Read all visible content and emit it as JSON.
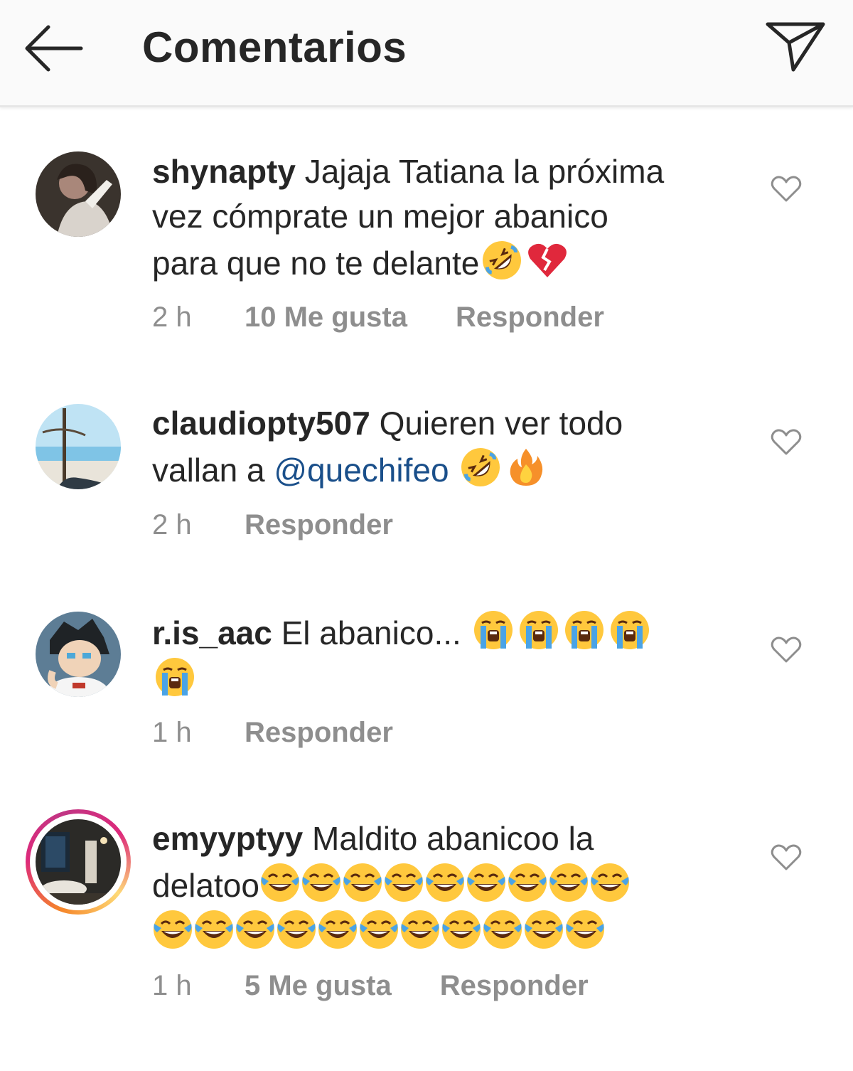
{
  "header": {
    "title": "Comentarios",
    "back_icon": "arrow-left-icon",
    "direct_icon": "paper-plane-icon"
  },
  "comments": [
    {
      "username": "shynapty",
      "text_lines": [
        "Jajaja Tatiana la próxima",
        "vez cómprate un mejor abanico",
        "para que no te delante"
      ],
      "emojis": [
        "rolling-on-floor-laughing",
        "broken-heart"
      ],
      "time": "2 h",
      "likes": "10 Me gusta",
      "reply": "Responder"
    },
    {
      "username": "claudiopty507",
      "text_first": "Quieren ver todo",
      "text_second": "vallan a",
      "mention": "@quechifeo",
      "emojis": [
        "rolling-on-floor-laughing",
        "fire"
      ],
      "time": "2 h",
      "reply": "Responder"
    },
    {
      "username": "r.is_aac",
      "text": "El abanico...",
      "emojis": [
        "loudly-crying",
        "loudly-crying",
        "loudly-crying",
        "loudly-crying",
        "loudly-crying"
      ],
      "time": "1 h",
      "reply": "Responder"
    },
    {
      "username": "emyyptyy",
      "text_first": "Maldito abanicoo  la",
      "text_second": "delatoo",
      "emojis_count": 20,
      "emoji": "face-with-tears-of-joy",
      "time": "1 h",
      "likes": "5 Me gusta",
      "reply": "Responder"
    }
  ],
  "colors": {
    "mention": "#1a4f8a",
    "meta": "#8e8e8e",
    "text": "#262626",
    "header_bg": "#fafafa"
  }
}
